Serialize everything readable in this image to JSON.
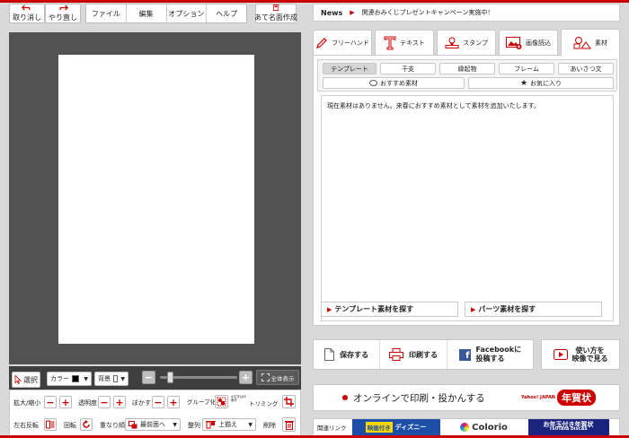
{
  "toolbar": {
    "undo_label": "取り消し",
    "redo_label": "やり直し",
    "menus": [
      "ファイル",
      "編集",
      "オプション",
      "ヘルプ"
    ],
    "address_label": "あて名面作成"
  },
  "canvas_controls": {
    "select_label": "選択",
    "color_label": "カラー",
    "background_label": "背景",
    "fit_all_label": "全体表示",
    "zoom_level": 0.1
  },
  "tools": {
    "scale_label": "拡大/縮小",
    "opacity_label": "透明度",
    "blur_label": "ぼかす",
    "group_label": "グループ化",
    "group_note": "※文字は対象外",
    "trim_label": "トリミング",
    "flip_label": "左右反転",
    "rotate_label": "回転",
    "order_label": "重なり順",
    "order_value": "最前面へ",
    "align_label": "整列",
    "align_value": "上揃え",
    "delete_label": "削除"
  },
  "news": {
    "label": "News",
    "text": "関連おみくじプレゼントキャンペーン実施中！"
  },
  "tabs": [
    {
      "label": "フリーハンド",
      "icon": "pen-icon"
    },
    {
      "label": "テキスト",
      "icon": "text-icon"
    },
    {
      "label": "スタンプ",
      "icon": "stamp-icon"
    },
    {
      "label": "画像読込",
      "icon": "image-icon"
    },
    {
      "label": "素材",
      "icon": "shapes-icon"
    }
  ],
  "material": {
    "categories": [
      "テンプレート",
      "干支",
      "縁起物",
      "フレーム",
      "あいさつ文"
    ],
    "recommended_label": "おすすめ素材",
    "favorites_label": "お気に入り",
    "empty_message": "現在素材はありません。来春におすすめ素材として素材を追加いたします。",
    "search_template_label": "テンプレート素材を探す",
    "search_parts_label": "パーツ素材を探す"
  },
  "actions": {
    "save_label": "保存する",
    "print_label": "印刷する",
    "facebook_label_1": "Facebookに",
    "facebook_label_2": "投稿する",
    "video_label_1": "使い方を",
    "video_label_2": "映像で見る"
  },
  "online": {
    "label": "オンラインで印刷・投かんする",
    "nenga_text": "年賀状",
    "nenga_brand": "Yahoo! JAPAN"
  },
  "links": {
    "label": "関連リンク",
    "banner1_a": "映画付き",
    "banner1_b": "ディズニー",
    "banner2": "Colorio",
    "banner3": "お年玉付き年賀状",
    "banner3_sub": "TSUTAYA DISCAS"
  },
  "colors": {
    "accent": "#cc0000",
    "canvas_bg": "#525252",
    "panel_bg": "#d9d9d9",
    "facebook": "#3b5998"
  }
}
